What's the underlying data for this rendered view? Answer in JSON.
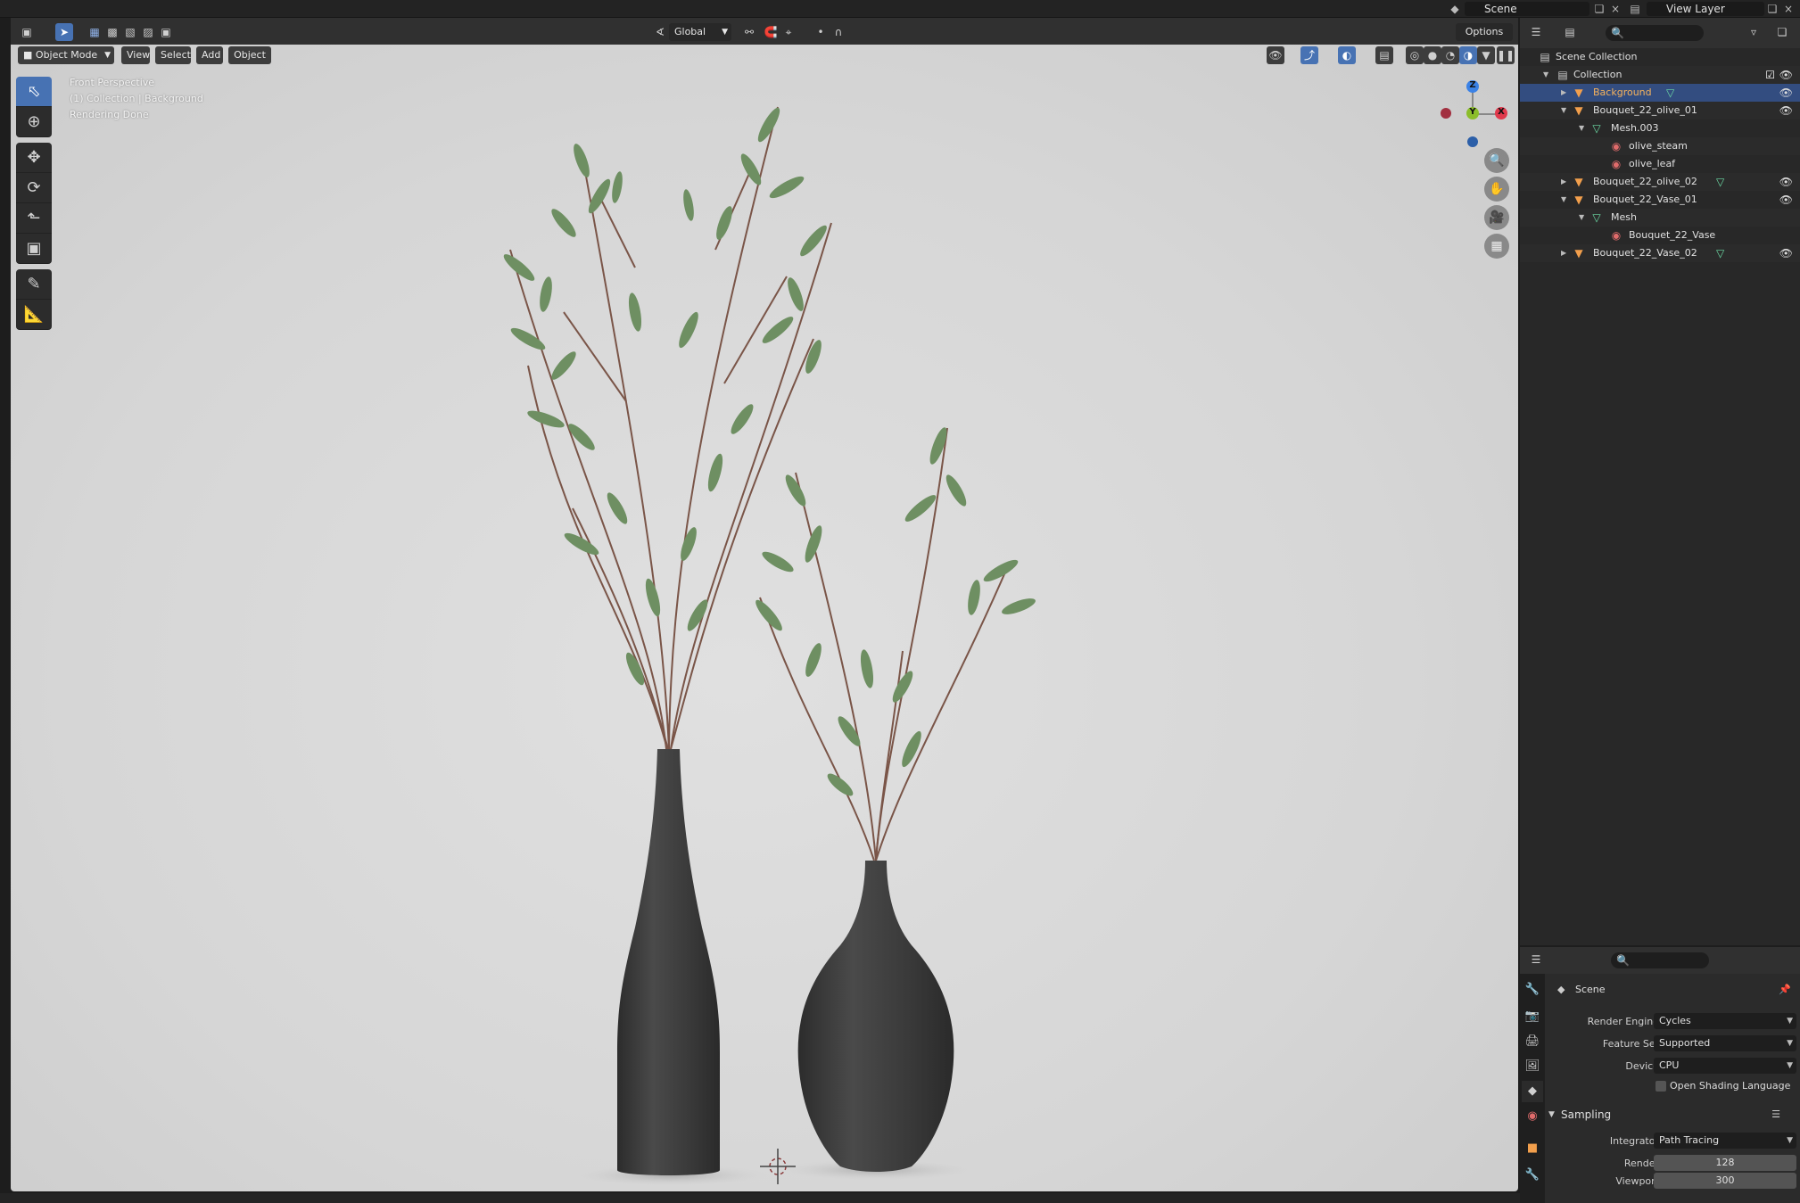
{
  "topbar": {
    "scene_label": "Scene",
    "view_layer_label": "View Layer"
  },
  "header": {
    "mode": "Object Mode",
    "menus": [
      "View",
      "Select",
      "Add",
      "Object"
    ],
    "transform_orientation": "Global",
    "options_label": "Options"
  },
  "viewport": {
    "info": [
      "Front Perspective",
      "(1) Collection | Background",
      "Rendering Done"
    ],
    "gizmo": {
      "z": "Z",
      "y": "Y",
      "x": "X"
    }
  },
  "outliner": {
    "rows": [
      {
        "label": "Scene Collection",
        "type": "scene"
      },
      {
        "label": "Collection",
        "type": "collection"
      },
      {
        "label": "Background",
        "type": "object",
        "selected": true
      },
      {
        "label": "Bouquet_22_olive_01",
        "type": "object"
      },
      {
        "label": "Mesh.003",
        "type": "mesh"
      },
      {
        "label": "olive_steam",
        "type": "material"
      },
      {
        "label": "olive_leaf",
        "type": "material"
      },
      {
        "label": "Bouquet_22_olive_02",
        "type": "object"
      },
      {
        "label": "Bouquet_22_Vase_01",
        "type": "object"
      },
      {
        "label": "Mesh",
        "type": "mesh"
      },
      {
        "label": "Bouquet_22_Vase",
        "type": "material"
      },
      {
        "label": "Bouquet_22_Vase_02",
        "type": "object"
      }
    ]
  },
  "properties": {
    "context": "Scene",
    "render_engine_label": "Render Engine",
    "render_engine": "Cycles",
    "feature_set_label": "Feature Set",
    "feature_set": "Supported",
    "device_label": "Device",
    "device": "CPU",
    "osl_label": "Open Shading Language",
    "sampling_label": "Sampling",
    "integrator_label": "Integrator",
    "integrator": "Path Tracing",
    "render_label": "Render",
    "render_samples": "128",
    "viewport_label": "Viewport",
    "viewport_samples": "300"
  },
  "colors": {
    "accent": "#4772b3",
    "selected_row": "#334d80",
    "axis_x": "#e0394c",
    "axis_y": "#8bbd2a",
    "axis_z": "#3b82e6"
  }
}
